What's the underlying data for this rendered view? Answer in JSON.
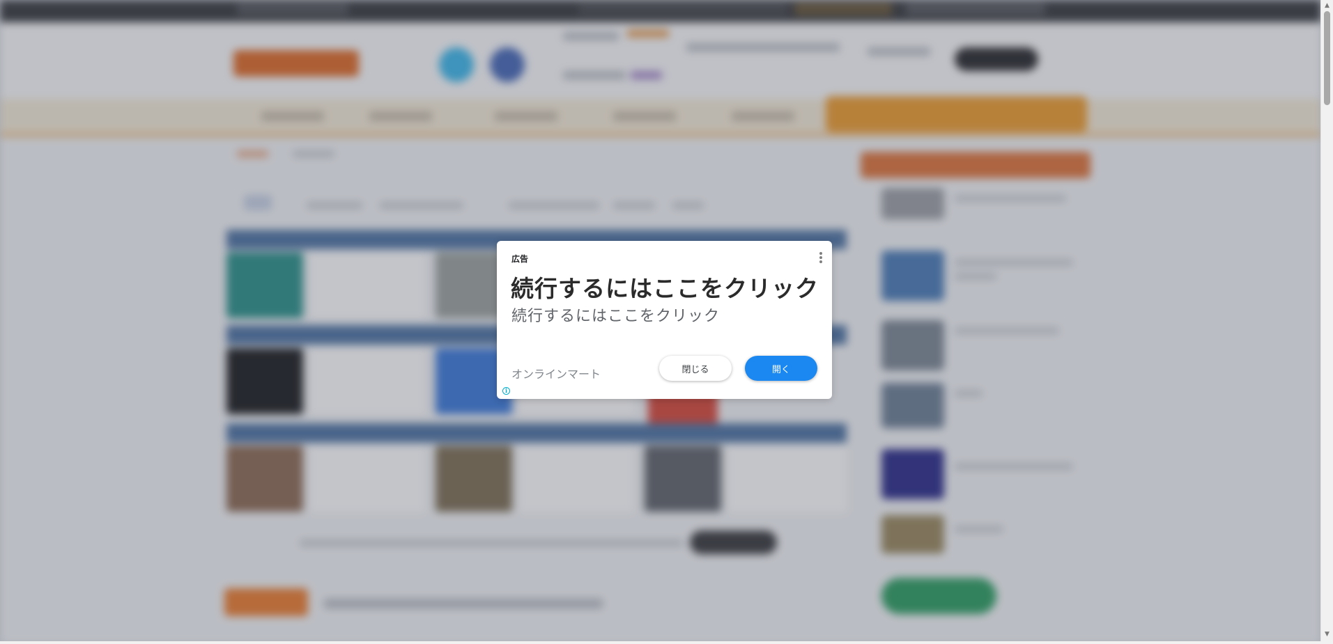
{
  "ad": {
    "label": "広告",
    "title": "続行するにはここをクリック",
    "subtitle": "続行するにはここをクリック",
    "advertiser": "オンラインマート",
    "close_label": "閉じる",
    "open_label": "開く",
    "info_glyph": "i",
    "menu_icon": "vertical-dots-icon",
    "accent_color": "#1a88f0"
  },
  "scrollbar": {
    "up_arrow": "▲",
    "down_arrow": "▼"
  }
}
